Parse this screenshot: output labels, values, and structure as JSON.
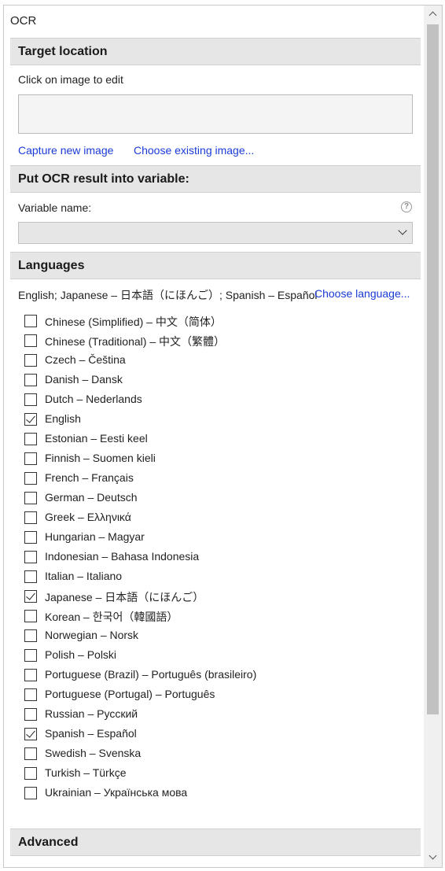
{
  "panel": {
    "title": "OCR"
  },
  "target": {
    "header": "Target location",
    "hint": "Click on image to edit",
    "capture_link": "Capture new image",
    "choose_link": "Choose existing image..."
  },
  "variable": {
    "header": "Put OCR result into variable:",
    "label": "Variable name:",
    "help_glyph": "?",
    "selected": ""
  },
  "languages": {
    "header": "Languages",
    "summary": "English; Japanese – 日本語（にほんご）; Spanish – Español",
    "choose_link": "Choose language...",
    "items": [
      {
        "label": "Chinese (Simplified) – 中文（简体）",
        "checked": false
      },
      {
        "label": "Chinese (Traditional) – 中文（繁體）",
        "checked": false
      },
      {
        "label": "Czech – Čeština",
        "checked": false
      },
      {
        "label": "Danish – Dansk",
        "checked": false
      },
      {
        "label": "Dutch – Nederlands",
        "checked": false
      },
      {
        "label": "English",
        "checked": true
      },
      {
        "label": "Estonian – Eesti keel",
        "checked": false
      },
      {
        "label": "Finnish – Suomen kieli",
        "checked": false
      },
      {
        "label": "French – Français",
        "checked": false
      },
      {
        "label": "German – Deutsch",
        "checked": false
      },
      {
        "label": "Greek – Ελληνικά",
        "checked": false
      },
      {
        "label": "Hungarian – Magyar",
        "checked": false
      },
      {
        "label": "Indonesian – Bahasa Indonesia",
        "checked": false
      },
      {
        "label": "Italian – Italiano",
        "checked": false
      },
      {
        "label": "Japanese – 日本語（にほんご）",
        "checked": true
      },
      {
        "label": "Korean – 한국어（韓國語）",
        "checked": false
      },
      {
        "label": "Norwegian – Norsk",
        "checked": false
      },
      {
        "label": "Polish – Polski",
        "checked": false
      },
      {
        "label": "Portuguese (Brazil) – Português (brasileiro)",
        "checked": false
      },
      {
        "label": "Portuguese (Portugal) – Português",
        "checked": false
      },
      {
        "label": "Russian – Русский",
        "checked": false
      },
      {
        "label": "Spanish – Español",
        "checked": true
      },
      {
        "label": "Swedish – Svenska",
        "checked": false
      },
      {
        "label": "Turkish – Türkçe",
        "checked": false
      },
      {
        "label": "Ukrainian – Українська мова",
        "checked": false
      }
    ]
  },
  "advanced": {
    "header": "Advanced"
  },
  "icons": {
    "scroll_up": "chevron-up-icon",
    "scroll_down": "chevron-down-icon",
    "dropdown": "chevron-down-icon",
    "help": "help-icon",
    "check": "checkmark-icon"
  },
  "colors": {
    "link": "#1a3bd6",
    "section_header_bg": "#e6e6e6",
    "scroll_thumb": "#c1c1c1"
  }
}
